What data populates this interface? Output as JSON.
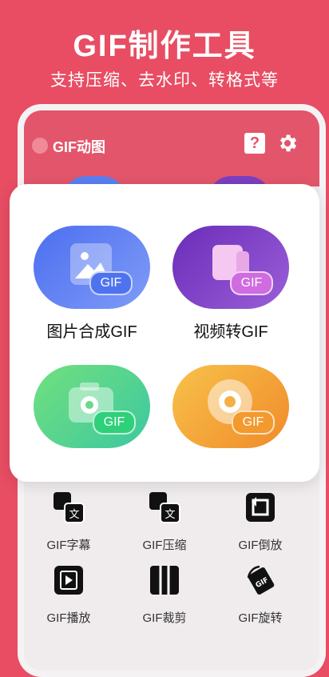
{
  "header": {
    "title": "GIF制作工具",
    "subtitle": "支持压缩、去水印、转格式等"
  },
  "app": {
    "title": "GIF动图"
  },
  "main_features": [
    {
      "label": "图片合成GIF",
      "badge": "GIF"
    },
    {
      "label": "视频转GIF",
      "badge": "GIF"
    },
    {
      "label": "",
      "badge": "GIF"
    },
    {
      "label": "",
      "badge": "GIF"
    }
  ],
  "tools": [
    {
      "label": "GIF字幕",
      "icon": "subtitle-icon"
    },
    {
      "label": "GIF压缩",
      "icon": "compress-icon"
    },
    {
      "label": "GIF倒放",
      "icon": "reverse-icon"
    },
    {
      "label": "GIF播放",
      "icon": "play-icon"
    },
    {
      "label": "GIF裁剪",
      "icon": "crop-icon"
    },
    {
      "label": "GIF旋转",
      "icon": "rotate-icon"
    }
  ],
  "icons": {
    "tool_glyph": "文",
    "rotate_glyph": "GIF",
    "help_glyph": "?"
  },
  "colors": {
    "background": "#e84d63",
    "blue": "#5b7ef0",
    "purple": "#7a3fc2",
    "green": "#4fd37a",
    "orange": "#f5a33a"
  }
}
